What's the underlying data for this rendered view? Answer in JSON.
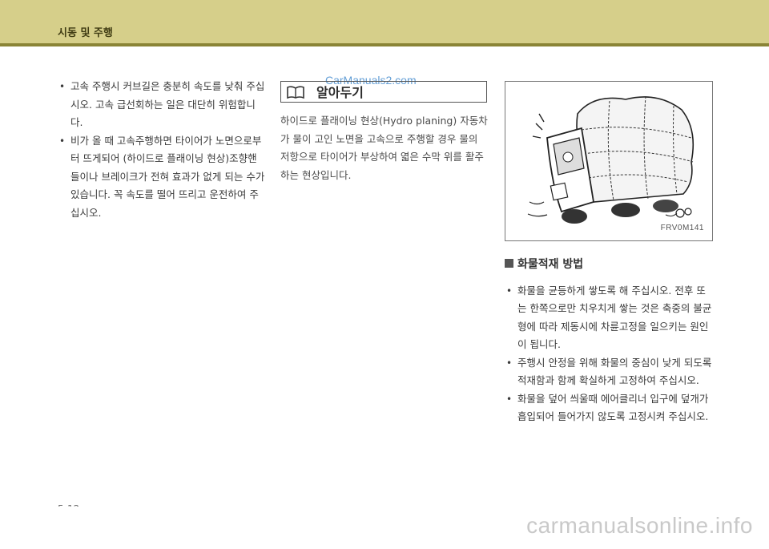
{
  "header": {
    "title": "시동 및 주행"
  },
  "left_column": {
    "bullets": [
      "고속 주행시 커브길은 충분히 속도를 낮춰 주십시오. 고속 급선회하는 일은 대단히 위험합니다.",
      "비가 올 때 고속주행하면 타이어가 노면으로부터 뜨게되어 (하이드로 플래이닝 현상)조향핸들이나 브레이크가 전혀 효과가 없게 되는 수가 있습니다. 꼭 속도를 떨어 뜨리고 운전하여 주십시오."
    ]
  },
  "note": {
    "icon": "open-book-icon",
    "title": "알아두기",
    "watermark": "CarManuals2.com",
    "body": "하이드로 플래이닝 현상(Hydro planing) 자동차가 물이 고인 노면을 고속으로 주행할 경우 물의 저항으로 타이어가 부상하여 엷은 수막 위를 활주하는 현상입니다."
  },
  "figure": {
    "code": "FRV0M141"
  },
  "section": {
    "title": "화물적재 방법",
    "bullets": [
      "화물을 균등하게 쌓도록 해 주십시오. 전후 또는 한쪽으로만 치우치게 쌓는 것은 축중의 불균형에 따라 제동시에 차륜고정을 일으키는 원인이 됩니다.",
      "주행시 안정을 위해 화물의 중심이 낮게 되도록 적재함과 함께 확실하게 고정하여 주십시오.",
      "화물을 덮어 씌울때 에어클리너 입구에 덮개가 흡입되어 들어가지 않도록 고정시켜 주십시오."
    ]
  },
  "page_number": "5-12",
  "footer": {
    "watermark": "carmanualsonline.info"
  }
}
